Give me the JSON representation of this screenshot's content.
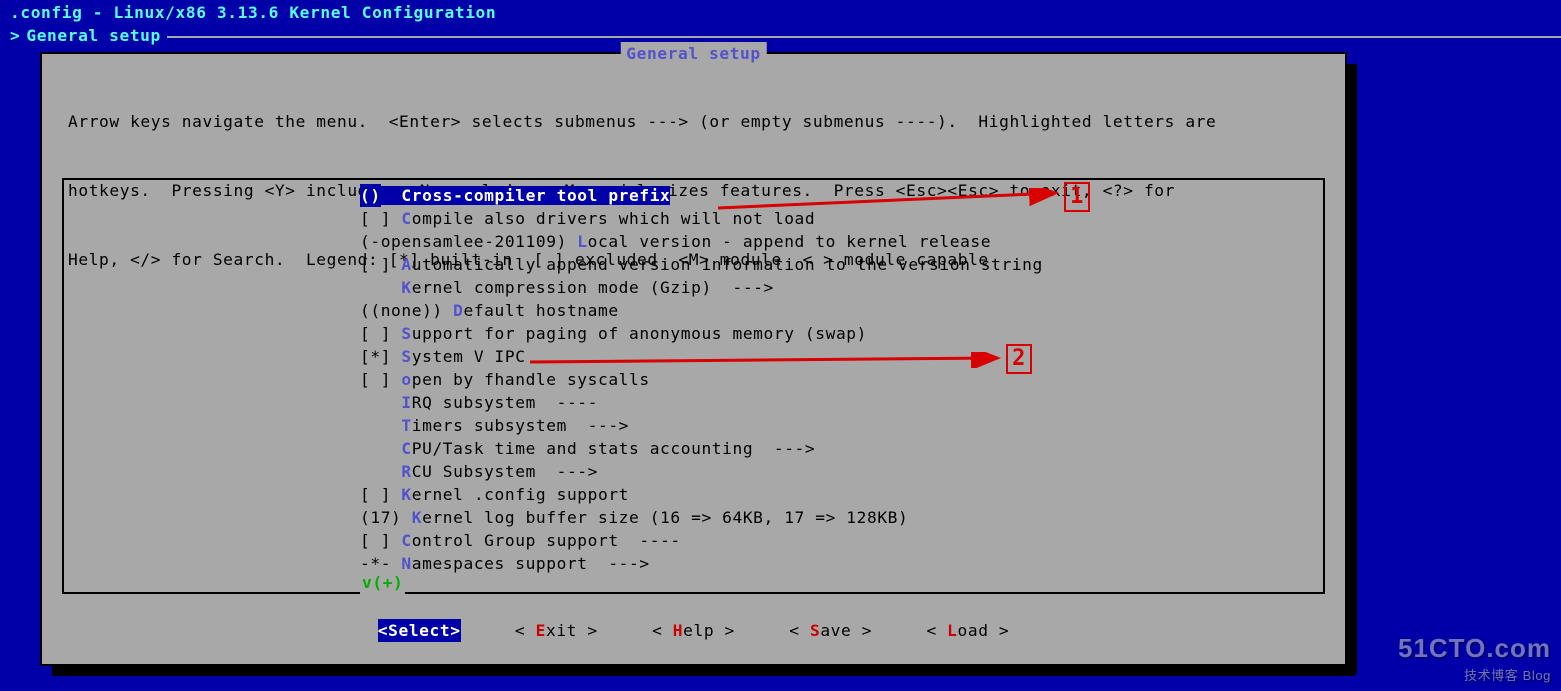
{
  "header": {
    "title": ".config - Linux/x86 3.13.6 Kernel Configuration",
    "breadcrumb_prefix": ">",
    "breadcrumb": "General setup"
  },
  "panel": {
    "title": "General setup",
    "help_line1": "Arrow keys navigate the menu.  <Enter> selects submenus ---> (or empty submenus ----).  Highlighted letters are",
    "help_line2": "hotkeys.  Pressing <Y> includes, <N> excludes, <M> modularizes features.  Press <Esc><Esc> to exit, <?> for",
    "help_line3": "Help, </> for Search.  Legend: [*] built-in  [ ] excluded  <M> module  < > module capable"
  },
  "menu": {
    "items": [
      {
        "state": "()",
        "hotkey": "C",
        "pre": "  ",
        "text": "ross-compiler tool prefix",
        "selected": true
      },
      {
        "state": "[ ]",
        "hotkey": "C",
        "pre": " ",
        "text": "ompile also drivers which will not load"
      },
      {
        "state": "(-opensamlee-201109)",
        "hotkey": "L",
        "pre": " ",
        "text": "ocal version - append to kernel release"
      },
      {
        "state": "[ ]",
        "hotkey": "A",
        "pre": " ",
        "text": "utomatically append version information to the version string"
      },
      {
        "state": "   ",
        "hotkey": "K",
        "pre": " ",
        "text": "ernel compression mode (Gzip)  --->"
      },
      {
        "state": "((none))",
        "hotkey": "D",
        "pre": " ",
        "text": "efault hostname"
      },
      {
        "state": "[ ]",
        "hotkey": "S",
        "pre": " ",
        "text": "upport for paging of anonymous memory (swap)"
      },
      {
        "state": "[*]",
        "hotkey": "S",
        "pre": " ",
        "text": "ystem V IPC"
      },
      {
        "state": "[ ]",
        "hotkey": "o",
        "pre": " ",
        "text": "pen by fhandle syscalls"
      },
      {
        "state": "   ",
        "hotkey": "I",
        "pre": " ",
        "text": "RQ subsystem  ----"
      },
      {
        "state": "   ",
        "hotkey": "T",
        "pre": " ",
        "text": "imers subsystem  --->"
      },
      {
        "state": "   ",
        "hotkey": "C",
        "pre": " ",
        "text": "PU/Task time and stats accounting  --->"
      },
      {
        "state": "   ",
        "hotkey": "R",
        "pre": " ",
        "text": "CU Subsystem  --->"
      },
      {
        "state": "[ ]",
        "hotkey": "K",
        "pre": " ",
        "text": "ernel .config support"
      },
      {
        "state": "(17)",
        "hotkey": "K",
        "pre": " ",
        "text": "ernel log buffer size (16 => 64KB, 17 => 128KB)"
      },
      {
        "state": "[ ]",
        "hotkey": "C",
        "pre": " ",
        "text": "ontrol Group support  ----"
      },
      {
        "state": "-*-",
        "hotkey": "N",
        "pre": " ",
        "text": "amespaces support  --->"
      }
    ],
    "scroll_indicator": "v(+)"
  },
  "buttons": {
    "select": {
      "open": "<",
      "hk": "S",
      "rest": "elect",
      "close": ">"
    },
    "exit": {
      "open": "< ",
      "hk": "E",
      "rest": "xit",
      "close": " >"
    },
    "help": {
      "open": "< ",
      "hk": "H",
      "rest": "elp",
      "close": " >"
    },
    "save": {
      "open": "< ",
      "hk": "S",
      "rest": "ave",
      "close": " >"
    },
    "load": {
      "open": "< ",
      "hk": "L",
      "rest": "oad",
      "close": " >"
    }
  },
  "annotations": {
    "a1": "1",
    "a2": "2"
  },
  "watermark": {
    "line1": "51CTO.com",
    "line2": "技术博客   Blog"
  }
}
